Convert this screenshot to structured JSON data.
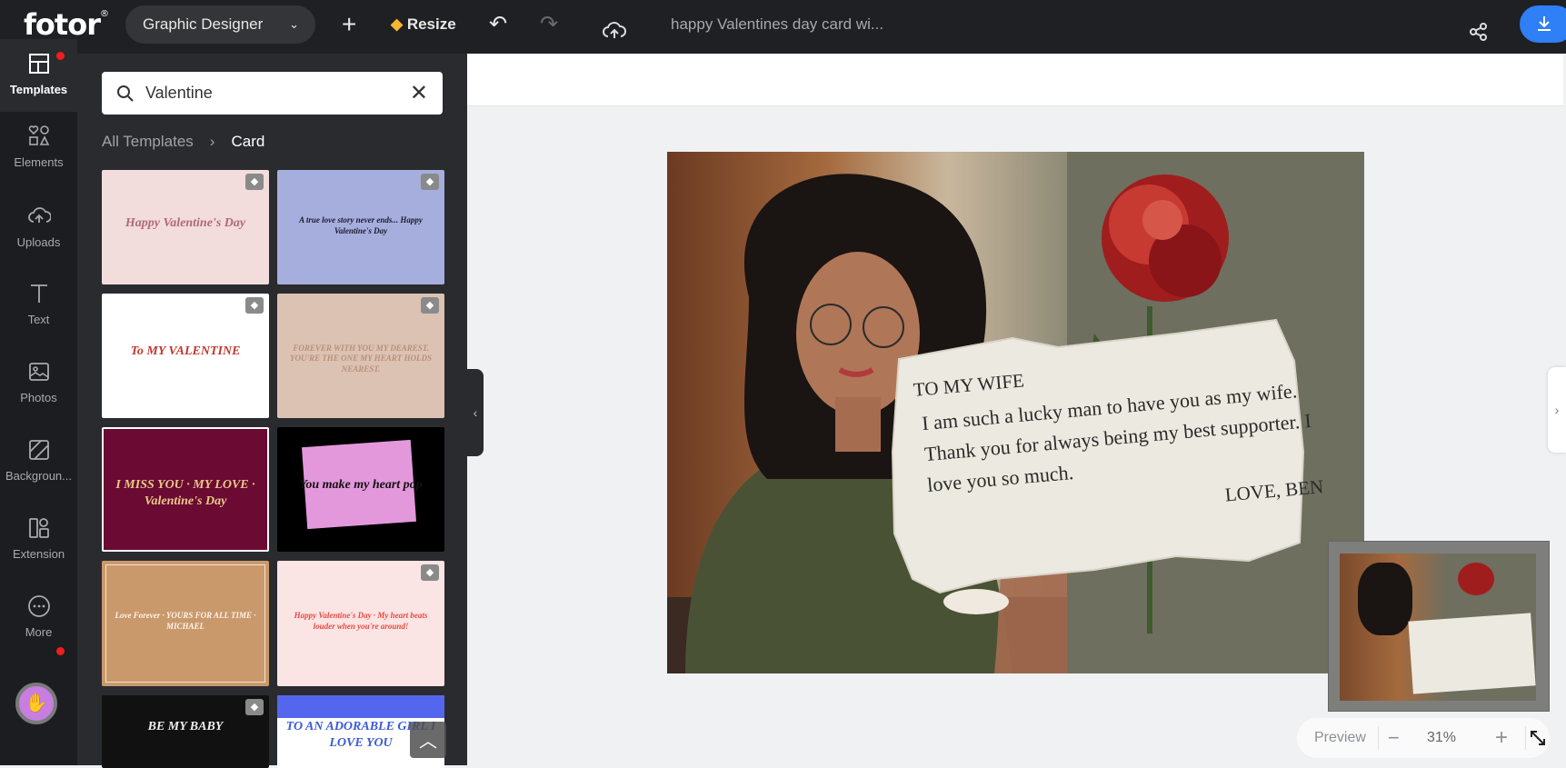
{
  "header": {
    "logo": "fotor",
    "logo_mark": "®",
    "role": "Graphic Designer",
    "resize": "Resize",
    "doc_title": "happy Valentines day card wi...",
    "icons": [
      "plus-icon",
      "diamond-icon",
      "undo-icon",
      "redo-icon",
      "cloud-upload-icon",
      "share-icon",
      "download-icon"
    ]
  },
  "rail": {
    "items": [
      {
        "label": "Templates",
        "icon": "templates-icon",
        "selected": true
      },
      {
        "label": "Elements",
        "icon": "shapes-icon"
      },
      {
        "label": "Uploads",
        "icon": "cloud-upload-icon"
      },
      {
        "label": "Text",
        "icon": "text-icon"
      },
      {
        "label": "Photos",
        "icon": "image-icon"
      },
      {
        "label": "Backgroun...",
        "icon": "background-icon"
      },
      {
        "label": "Extension",
        "icon": "extension-icon"
      },
      {
        "label": "More",
        "icon": "more-icon"
      }
    ]
  },
  "panel": {
    "search_value": "Valentine",
    "breadcrumb": [
      "All Templates",
      "Card"
    ],
    "templates": [
      {
        "text": "Happy Valentine's Day",
        "bg": "#f2dcdc",
        "fg": "#b06a7a",
        "premium": true
      },
      {
        "text": "A true love story never ends... Happy Valentine's Day",
        "bg": "#a5aedc",
        "fg": "#1a1a2e",
        "premium": true
      },
      {
        "text": "To MY VALENTINE",
        "bg": "#ffffff",
        "fg": "#c0392b",
        "premium": true
      },
      {
        "text": "FOREVER WITH YOU MY DEAREST. YOU'RE THE ONE MY HEART HOLDS NEAREST.",
        "bg": "#dcc2b3",
        "fg": "#b8907a",
        "premium": true
      },
      {
        "text": "I MISS YOU · MY LOVE · Valentine's Day",
        "bg": "#6b0a32",
        "fg": "#e8c98a",
        "premium": false
      },
      {
        "text": "You make my heart pop",
        "bg": "#000000",
        "fg": "#111111",
        "premium": false
      },
      {
        "text": "Love Forever · YOURS FOR ALL TIME · MICHAEL",
        "bg": "#c9996c",
        "fg": "#fff5ea",
        "premium": false
      },
      {
        "text": "Happy Valentine's Day · My heart beats louder when you're around!",
        "bg": "#fbe4e4",
        "fg": "#e84a3f",
        "premium": true
      },
      {
        "text": "BE MY BABY",
        "bg": "#111111",
        "fg": "#eeeeee",
        "premium": true
      },
      {
        "text": "TO AN ADORABLE GIRL I LOVE YOU",
        "bg": "#ffffff",
        "fg": "#3b5bd6",
        "premium": false
      }
    ]
  },
  "card": {
    "heading": "TO MY WIFE",
    "body": "I am such a lucky man to have you as my wife. Thank you for always being my best supporter. I love you so much.",
    "signoff": "LOVE, BEN"
  },
  "zoom": {
    "preview": "Preview",
    "level": "31%"
  },
  "colors": {
    "accent": "#2f7ff6",
    "topbar": "#1f2023",
    "panel": "#2a2b2f",
    "notification": "#f01e1e"
  }
}
